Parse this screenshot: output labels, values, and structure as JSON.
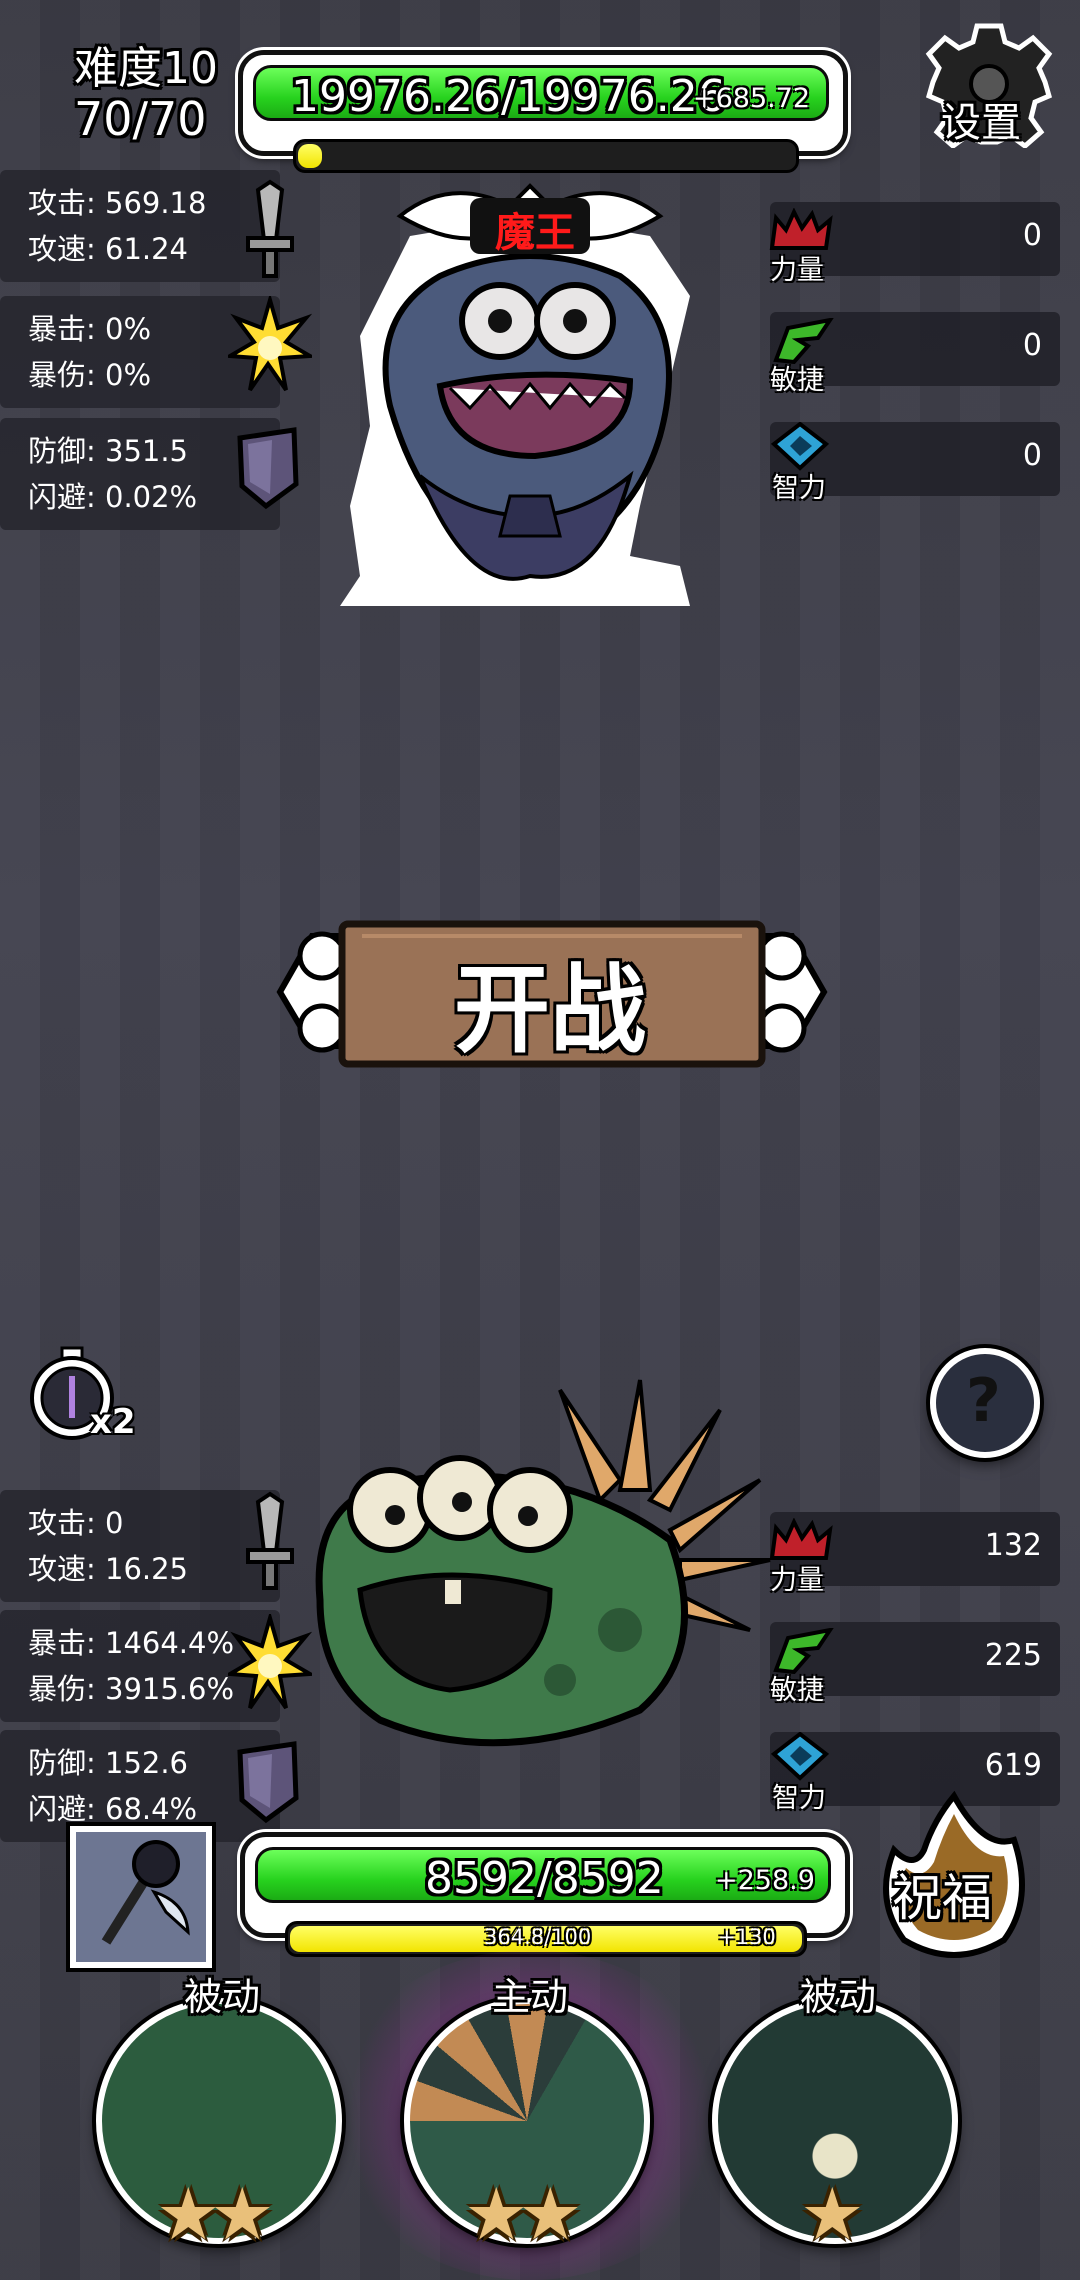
{
  "header": {
    "difficulty": "难度10",
    "stage": "70/70",
    "settings_label": "设置"
  },
  "boss": {
    "hp_text": "19976.26/19976.26",
    "hp_regen": "+685.72",
    "name": "魔王",
    "stats": [
      {
        "l1": "攻击: 569.18",
        "l2": "攻速: 61.24",
        "icon": "sword-icon"
      },
      {
        "l1": "暴击: 0%",
        "l2": "暴伤: 0%",
        "icon": "burst-icon"
      },
      {
        "l1": "防御: 351.5",
        "l2": "闪避: 0.02%",
        "icon": "shield-icon"
      }
    ],
    "attrs": [
      {
        "label": "力量",
        "value": "0"
      },
      {
        "label": "敏捷",
        "value": "0"
      },
      {
        "label": "智力",
        "value": "0"
      }
    ]
  },
  "battle": {
    "start_label": "开战",
    "speed_label": "x2",
    "help_label": "?"
  },
  "player": {
    "stats": [
      {
        "l1": "攻击: 0",
        "l2": "攻速: 16.25",
        "icon": "sword-icon"
      },
      {
        "l1": "暴击: 1464.4%",
        "l2": "暴伤: 3915.6%",
        "icon": "burst-icon"
      },
      {
        "l1": "防御: 152.6",
        "l2": "闪避: 68.4%",
        "icon": "shield-icon"
      }
    ],
    "attrs": [
      {
        "label": "力量",
        "value": "132"
      },
      {
        "label": "敏捷",
        "value": "225"
      },
      {
        "label": "智力",
        "value": "619"
      }
    ],
    "hp_text": "8592/8592",
    "hp_regen": "+258.9",
    "energy_text": "364.8/100",
    "energy_regen": "+130",
    "energy_fraction": 1,
    "bless_label": "祝福"
  },
  "skills": [
    {
      "type": "被动",
      "stars": 2
    },
    {
      "type": "主动",
      "stars": 2
    },
    {
      "type": "被动",
      "stars": 1
    }
  ],
  "colors": {
    "hp_green": "#27d21e",
    "boss_name": "#ff1a1a",
    "energy_yellow": "#f2e400",
    "wood": "#9a7256"
  }
}
